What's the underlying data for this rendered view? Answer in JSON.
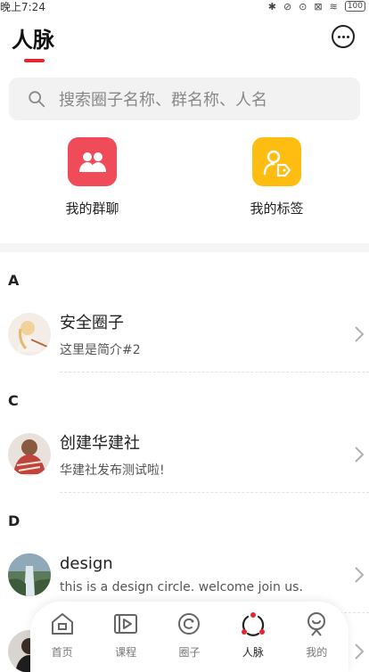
{
  "status_bar": {
    "time": "晚上7:24",
    "battery": "100"
  },
  "header": {
    "title": "人脉"
  },
  "search": {
    "placeholder": "搜索圈子名称、群名称、人名"
  },
  "shortcuts": [
    {
      "label": "我的群聊",
      "icon": "group-chat-icon",
      "color": "#f04b58"
    },
    {
      "label": "我的标签",
      "icon": "tag-icon",
      "color": "#ffbd11"
    }
  ],
  "sections": [
    {
      "letter": "A",
      "items": [
        {
          "name": "安全圈子",
          "intro": "这里是简介#2"
        }
      ]
    },
    {
      "letter": "C",
      "items": [
        {
          "name": "创建华建社",
          "intro": "华建社发布测试啦!"
        }
      ]
    },
    {
      "letter": "D",
      "items": [
        {
          "name": "design",
          "intro": "this is a design circle. welcome join us."
        },
        {
          "name": "",
          "intro": ""
        }
      ]
    }
  ],
  "tabs": [
    {
      "label": "首页",
      "icon": "home-icon"
    },
    {
      "label": "课程",
      "icon": "course-icon"
    },
    {
      "label": "圈子",
      "icon": "circle-icon"
    },
    {
      "label": "人脉",
      "icon": "connections-icon",
      "active": true
    },
    {
      "label": "我的",
      "icon": "profile-icon"
    }
  ],
  "colors": {
    "accent": "#e8262f",
    "group_chat": "#f04b58",
    "tag": "#ffbd11"
  }
}
